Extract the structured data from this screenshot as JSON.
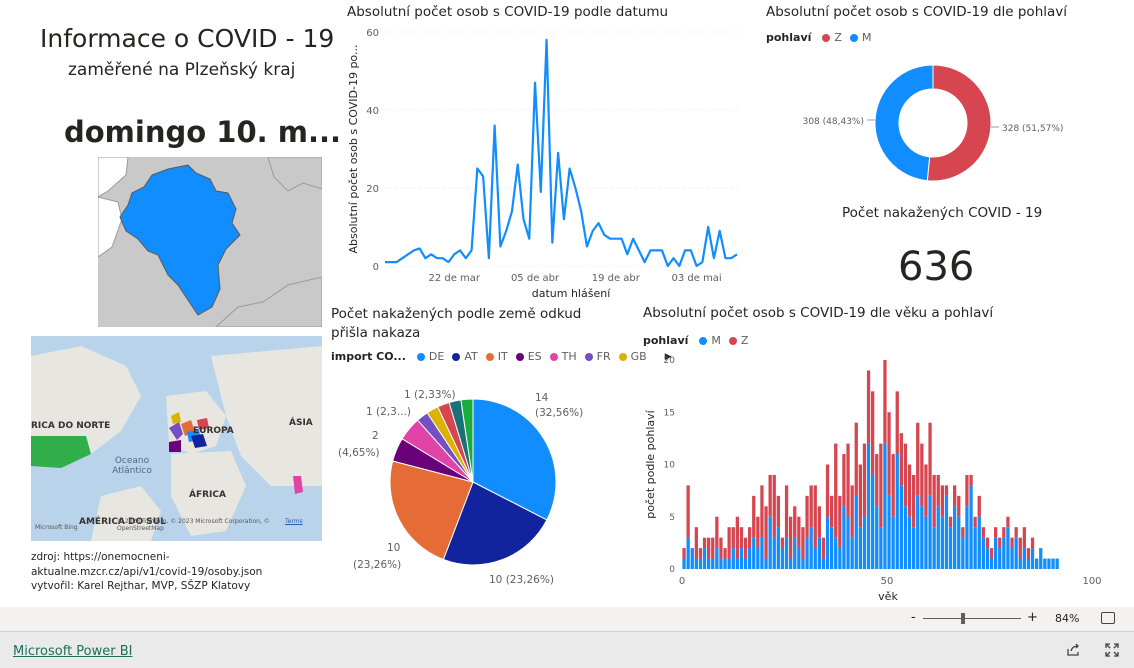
{
  "header": {
    "title": "Informace o COVID - 19",
    "subtitle": "zaměřené na Plzeňský kraj",
    "date_card": "domingo 10. m..."
  },
  "footer_text": {
    "source": "zdroj: https://onemocneni-aktualne.mzcr.cz/api/v1/covid-19/osoby.json",
    "author": "vytvořil: Karel Rejthar, MVP, SŠZP Klatovy"
  },
  "world_map": {
    "labels": [
      "RICA DO NORTE",
      "EUROPA",
      "ÁSIA",
      "Oceano Atlântico",
      "ÁFRICA",
      "AMÉRICA DO SUL"
    ],
    "attribution": "© 2023 TomTom, © 2023 Microsoft Corporation, © OpenStreetMap",
    "terms": "Terms",
    "logo": "Microsoft Bing"
  },
  "kpi": {
    "label": "Počet nakažených COVID - 19",
    "value": "636"
  },
  "bottom_bar": {
    "brand": "Microsoft Power BI",
    "zoom_minus": "-",
    "zoom_plus": "+",
    "zoom_level": "84%",
    "fit_icon": "fit-to-page-icon",
    "share_icon": "share-icon",
    "fullscreen_icon": "fullscreen-icon"
  },
  "colors": {
    "blue": "#118dff",
    "navy": "#12239e",
    "orange": "#e66c37",
    "purple": "#6b007b",
    "pink": "#e044a7",
    "violet": "#744ec2",
    "yellow": "#d9b300",
    "red": "#d64550",
    "green": "#1aab40",
    "teal": "#197278",
    "map_fill": "#118dff",
    "map_bg": "#c8c8c8"
  },
  "chart_data": [
    {
      "type": "line",
      "title": "Absolutní počet osob s COVID-19 podle datumu",
      "xlabel": "datum hlášení",
      "ylabel": "Absolutní počet osob s COVID-19 po...",
      "ylim": [
        0,
        60
      ],
      "yticks": [
        "0",
        "20",
        "40",
        "60"
      ],
      "xticks": [
        "22 de mar",
        "05 de abr",
        "19 de abr",
        "03 de mai"
      ],
      "x_tick_days": [
        12,
        26,
        40,
        54
      ],
      "x_days": [
        0,
        1,
        2,
        3,
        4,
        5,
        6,
        7,
        8,
        9,
        10,
        11,
        12,
        13,
        14,
        15,
        16,
        17,
        18,
        19,
        20,
        21,
        22,
        23,
        24,
        25,
        26,
        27,
        28,
        29,
        30,
        31,
        32,
        33,
        34,
        35,
        36,
        37,
        38,
        39,
        40,
        41,
        42,
        43,
        44,
        45,
        46,
        47,
        48,
        49,
        50,
        51,
        52,
        53,
        54,
        55,
        56,
        57,
        58,
        59,
        60,
        61
      ],
      "values": [
        1,
        1,
        1,
        2,
        3,
        4,
        4.5,
        2,
        3,
        2,
        2,
        1,
        3,
        4,
        2,
        4,
        25,
        23,
        2,
        36,
        5,
        9,
        14,
        26,
        12,
        7,
        47,
        19,
        58,
        6,
        29,
        12,
        25,
        20,
        14,
        5,
        9,
        11,
        8,
        7,
        7,
        7,
        3,
        7,
        4,
        1,
        4,
        4,
        4,
        0,
        2,
        0,
        4,
        4,
        0,
        1,
        10,
        2,
        9,
        2,
        2,
        3
      ],
      "series": [
        {
          "name": "",
          "color": "#118dff"
        }
      ],
      "grid": true
    },
    {
      "type": "pie",
      "title": "Absolutní počet osob s COVID-19 dle pohlaví",
      "donut": true,
      "legend_title": "pohlaví",
      "categories": [
        "Z",
        "M"
      ],
      "values": [
        328,
        308
      ],
      "labels": [
        "328 (51,57%)",
        "308 (48,43%)"
      ],
      "colors": [
        "#d64550",
        "#118dff"
      ],
      "legend_position": "top-left"
    },
    {
      "type": "pie",
      "title": "Počet nakažených podle země odkud přišla nakaza",
      "legend_title": "import CO...",
      "categories": [
        "DE",
        "AT",
        "IT",
        "ES",
        "TH",
        "FR",
        "GB",
        "",
        "",
        ""
      ],
      "values": [
        14,
        10,
        10,
        2,
        2,
        1,
        1,
        1,
        1,
        1
      ],
      "colors": [
        "#118dff",
        "#12239e",
        "#e66c37",
        "#6b007b",
        "#e044a7",
        "#744ec2",
        "#d9b300",
        "#d64550",
        "#197278",
        "#1aab40"
      ],
      "labels": {
        "DE": [
          "14",
          "(32,56%)"
        ],
        "AT": [
          "10 (23,26%)"
        ],
        "IT": [
          "10",
          "(23,26%)"
        ],
        "ES": [
          "2",
          "(4,65%)"
        ],
        "small_1": [
          "1 (2,3...)"
        ],
        "small_2": [
          "1 (2,33%)"
        ]
      },
      "legend_position": "top-left"
    },
    {
      "type": "bar",
      "stacked": true,
      "title": "Absolutní počet osob s COVID-19 dle věku a pohlaví",
      "legend_title": "pohlaví",
      "xlabel": "věk",
      "ylabel": "počet podle pohlaví",
      "xlim": [
        0,
        100
      ],
      "ylim": [
        0,
        20
      ],
      "xticks": [
        "0",
        "50",
        "100"
      ],
      "yticks": [
        "0",
        "5",
        "10",
        "15",
        "20"
      ],
      "ages": [
        0,
        1,
        2,
        3,
        4,
        5,
        6,
        7,
        8,
        9,
        10,
        11,
        12,
        13,
        14,
        15,
        16,
        17,
        18,
        19,
        20,
        21,
        22,
        23,
        24,
        25,
        26,
        27,
        28,
        29,
        30,
        31,
        32,
        33,
        34,
        35,
        36,
        37,
        38,
        39,
        40,
        41,
        42,
        43,
        44,
        45,
        46,
        47,
        48,
        49,
        50,
        51,
        52,
        53,
        54,
        55,
        56,
        57,
        58,
        59,
        60,
        61,
        62,
        63,
        64,
        65,
        66,
        67,
        68,
        69,
        70,
        71,
        72,
        73,
        74,
        75,
        76,
        77,
        78,
        79,
        80,
        81,
        82,
        83,
        84,
        85,
        86,
        87,
        88,
        89,
        90,
        91
      ],
      "series": [
        {
          "name": "M",
          "color": "#118dff",
          "values": [
            1,
            3,
            2,
            1,
            1,
            2,
            1,
            1,
            2,
            1,
            1,
            1,
            2,
            1,
            2,
            1,
            2,
            3,
            2,
            3,
            1,
            5,
            3,
            4,
            2,
            3,
            1,
            3,
            2,
            1,
            3,
            4,
            2,
            3,
            1,
            5,
            4,
            3,
            2,
            6,
            5,
            3,
            7,
            4,
            5,
            12,
            9,
            6,
            4,
            12,
            7,
            5,
            11,
            8,
            6,
            5,
            4,
            7,
            6,
            5,
            7,
            4,
            6,
            5,
            7,
            4,
            6,
            5,
            3,
            6,
            8,
            4,
            5,
            3,
            2,
            1,
            3,
            2,
            3,
            4,
            2,
            3,
            1,
            2,
            1,
            2,
            1,
            2,
            1,
            1,
            1,
            1
          ]
        },
        {
          "name": "Z",
          "color": "#d64550",
          "values": [
            1,
            5,
            0,
            3,
            1,
            1,
            2,
            2,
            3,
            2,
            1,
            3,
            2,
            4,
            2,
            2,
            2,
            4,
            3,
            5,
            5,
            4,
            6,
            3,
            1,
            5,
            4,
            3,
            3,
            3,
            4,
            4,
            6,
            3,
            2,
            5,
            3,
            9,
            5,
            5,
            7,
            5,
            7,
            6,
            7,
            7,
            8,
            5,
            8,
            8,
            8,
            6,
            6,
            5,
            6,
            5,
            5,
            7,
            6,
            5,
            7,
            5,
            3,
            3,
            1,
            1,
            2,
            2,
            1,
            3,
            1,
            1,
            2,
            1,
            1,
            1,
            1,
            1,
            1,
            1,
            1,
            1,
            2,
            2,
            1,
            1,
            0,
            0,
            0,
            0,
            0,
            0
          ]
        }
      ],
      "grid": false
    }
  ]
}
